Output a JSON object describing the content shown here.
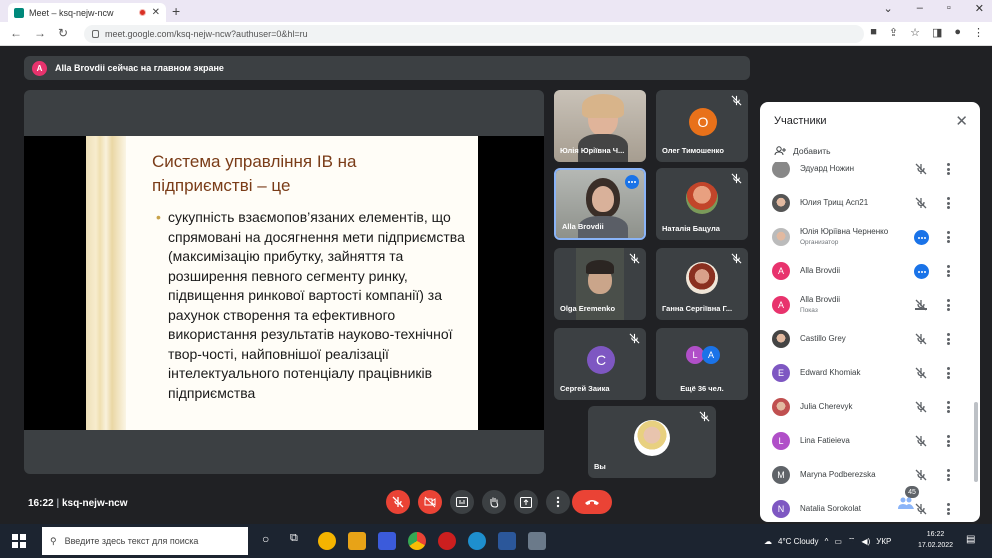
{
  "browser": {
    "tab_title": "Meet – ksq-nejw-ncw",
    "url": "meet.google.com/ksq-nejw-ncw?authuser=0&hl=ru"
  },
  "meet": {
    "presenting_avatar": "A",
    "presenting_text": "Alla Brovdii сейчас на главном экране",
    "slide": {
      "title": "Система управління ІВ на підприємстві – це",
      "bullet": "сукупність взаємопов’язаних елементів, що спрямовані на досягнення мети підприємства (максимізацію прибутку, зайняття та розширення певного сегменту ринку, підвищення ринкової вартості компанії) за рахунок створення та ефективного використання результатів науково-технічної твор-чості, найповнішої реалізації інтелектуального потенціалу працівників підприємства"
    },
    "tiles": [
      {
        "name": "Юлія Юріївна Ч...",
        "type": "video"
      },
      {
        "name": "Олег Тимошенко",
        "avatar": "О",
        "type": "avatar",
        "color": "#e8711a"
      },
      {
        "name": "Alla Brovdii",
        "type": "video",
        "speaking": true
      },
      {
        "name": "Наталія Бацула",
        "type": "photo"
      },
      {
        "name": "Olga Eremenko",
        "type": "video"
      },
      {
        "name": "Ганна Сергіївна Г...",
        "type": "photo"
      },
      {
        "name": "Сергей Заика",
        "avatar": "С",
        "type": "avatar",
        "color": "#7e57c2"
      },
      {
        "name": "Ещё 36 чел.",
        "type": "more",
        "avatars": [
          "L",
          "A"
        ]
      },
      {
        "name": "Вы",
        "type": "photo"
      }
    ],
    "time": "16:22",
    "separator": "|",
    "meeting_code": "ksq-nejw-ncw",
    "participants_count": "45"
  },
  "panel": {
    "title": "Участники",
    "add_label": "Добавить",
    "participants": [
      {
        "name": "Эдуард Ножин",
        "av": "",
        "color": "#888"
      },
      {
        "name": "Юлия Трищ Асп21",
        "av": "",
        "color": "#555",
        "photo": true
      },
      {
        "name": "Юлія Юріївна Черненко",
        "sub": "Организатор",
        "av": "",
        "color": "#bbb",
        "photo": true,
        "speaking": true
      },
      {
        "name": "Alla Brovdii",
        "av": "A",
        "color": "#e8336d",
        "speaking": true
      },
      {
        "name": "Alla Brovdii",
        "sub": "Показ",
        "av": "A",
        "color": "#e8336d",
        "present": true
      },
      {
        "name": "Castillo Grey",
        "av": "",
        "color": "#444",
        "photo": true
      },
      {
        "name": "Edward Khomiak",
        "av": "E",
        "color": "#7e57c2"
      },
      {
        "name": "Julia Cherevyk",
        "av": "",
        "color": "#c05050",
        "photo": true
      },
      {
        "name": "Lina Fatieieva",
        "av": "L",
        "color": "#b04fc8"
      },
      {
        "name": "Maryna Podberezska",
        "av": "M",
        "color": "#5f6368"
      },
      {
        "name": "Natalia Sorokolat",
        "av": "N",
        "color": "#7e57c2"
      }
    ]
  },
  "taskbar": {
    "search_placeholder": "Введите здесь текст для поиска",
    "weather": "4°C Cloudy",
    "lang": "УКР",
    "time": "16:22",
    "date": "17.02.2022"
  }
}
